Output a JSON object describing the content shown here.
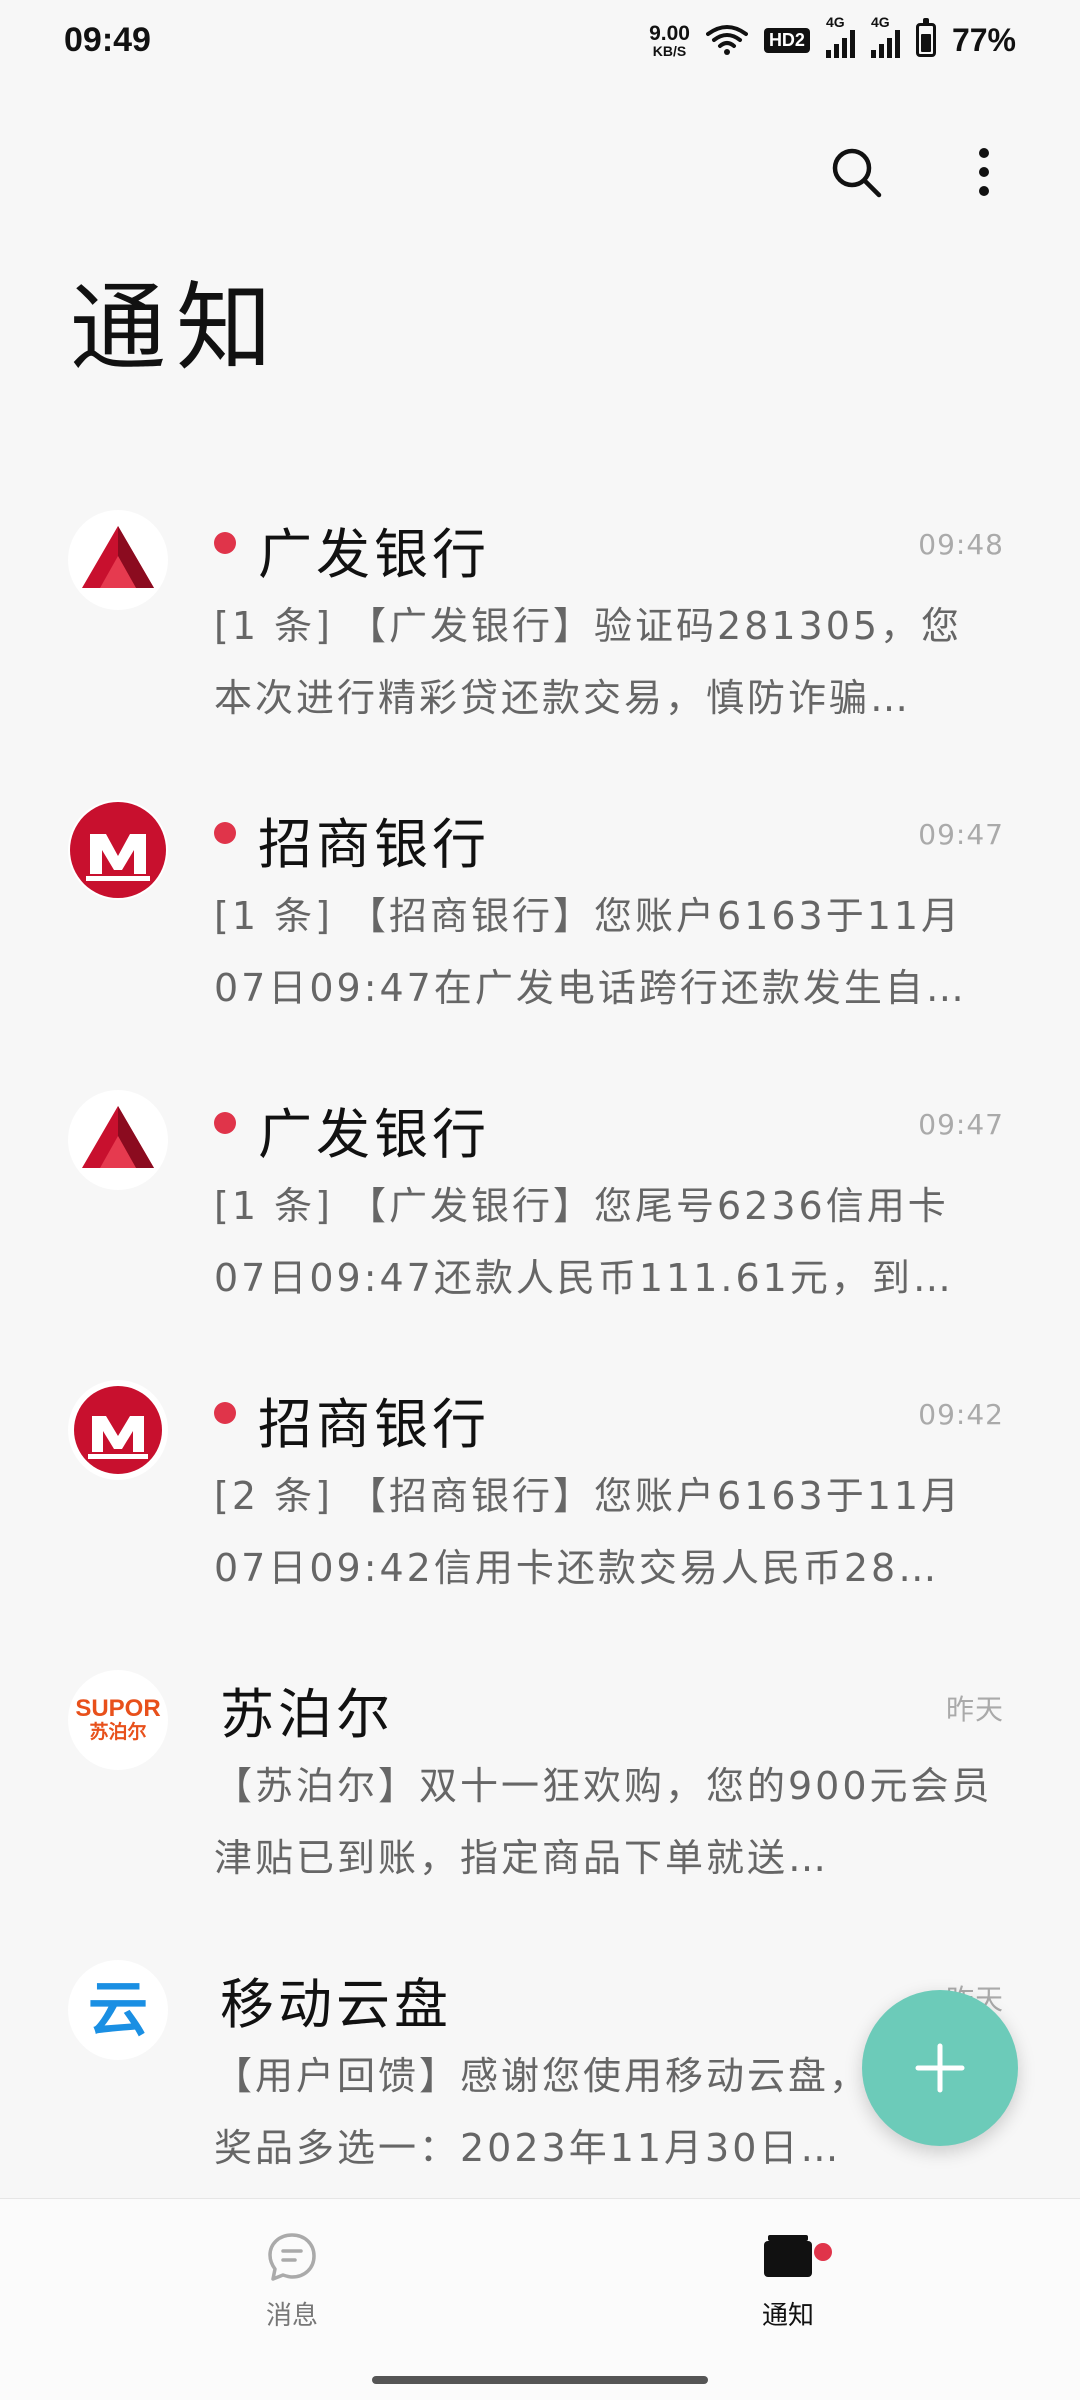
{
  "status_bar": {
    "time": "09:49",
    "net_speed_value": "9.00",
    "net_speed_unit": "KB/S",
    "hd_label": "HD2",
    "sim1_label": "4G",
    "sim2_label": "4G",
    "battery_percent": "77%",
    "battery_level": 0.77
  },
  "header": {
    "title": "通知",
    "search_icon": "search-icon",
    "more_icon": "more-vertical-icon"
  },
  "notifications": [
    {
      "sender": "广发银行",
      "time": "09:48",
      "preview": "[1 条] 【广发银行】验证码281305，您本次进行精彩贷还款交易，慎防诈骗…",
      "unread": true,
      "avatar": "cgb-logo"
    },
    {
      "sender": "招商银行",
      "time": "09:47",
      "preview": "[1 条] 【招商银行】您账户6163于11月07日09:47在广发电话跨行还款发生自…",
      "unread": true,
      "avatar": "cmb-logo"
    },
    {
      "sender": "广发银行",
      "time": "09:47",
      "preview": "[1 条] 【广发银行】您尾号6236信用卡07日09:47还款人民币111.61元，到账…",
      "unread": true,
      "avatar": "cgb-logo"
    },
    {
      "sender": "招商银行",
      "time": "09:42",
      "preview": "[2 条] 【招商银行】您账户6163于11月07日09:42信用卡还款交易人民币28…",
      "unread": true,
      "avatar": "cmb-logo"
    },
    {
      "sender": "苏泊尔",
      "time": "昨天",
      "preview": "【苏泊尔】双十一狂欢购，您的900元会员津贴已到账，指定商品下单就送…",
      "unread": false,
      "avatar": "supor-logo",
      "avatar_text_top": "SUPOR",
      "avatar_text_bottom": "苏泊尔"
    },
    {
      "sender": "移动云盘",
      "time": "昨天",
      "preview": "【用户回馈】感谢您使用移动云盘，您免费奖品多选一：2023年11月30日…",
      "unread": false,
      "avatar": "mcloud-logo",
      "avatar_glyph": "云"
    }
  ],
  "fab": {
    "icon": "plus-icon",
    "color": "#6ccbb9"
  },
  "bottom_nav": {
    "messages_label": "消息",
    "notices_label": "通知",
    "messages_icon": "chat-bubble-icon",
    "notices_icon": "inbox-icon"
  },
  "colors": {
    "unread_dot": "#e0344a",
    "cgb_red": "#c8102e",
    "cmb_red": "#c8102e",
    "supor_orange": "#e8501b",
    "mcloud_blue": "#1a8fe3"
  }
}
